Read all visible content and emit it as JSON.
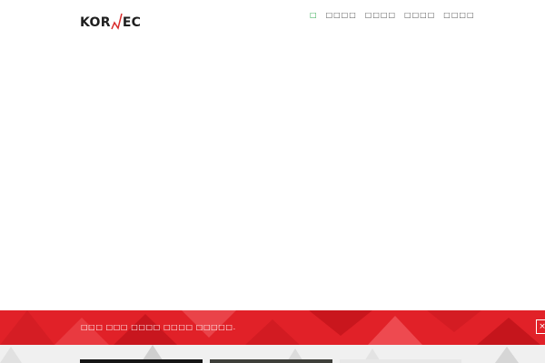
{
  "header": {
    "logo": {
      "left": "KOR",
      "mid": "N",
      "right": "EC"
    },
    "nav": {
      "items": [
        {
          "label": "□",
          "active": true
        },
        {
          "label": "□□□□",
          "active": false
        },
        {
          "label": "□□□□",
          "active": false
        },
        {
          "label": "□□□□",
          "active": false
        },
        {
          "label": "□□□□",
          "active": false
        }
      ]
    }
  },
  "banner": {
    "text": "□□□ □□□ □□□□ □□□□ □□□□□.",
    "close_label": "×"
  },
  "colors": {
    "accent": "#e12128",
    "nav_active": "#2aa84a"
  }
}
